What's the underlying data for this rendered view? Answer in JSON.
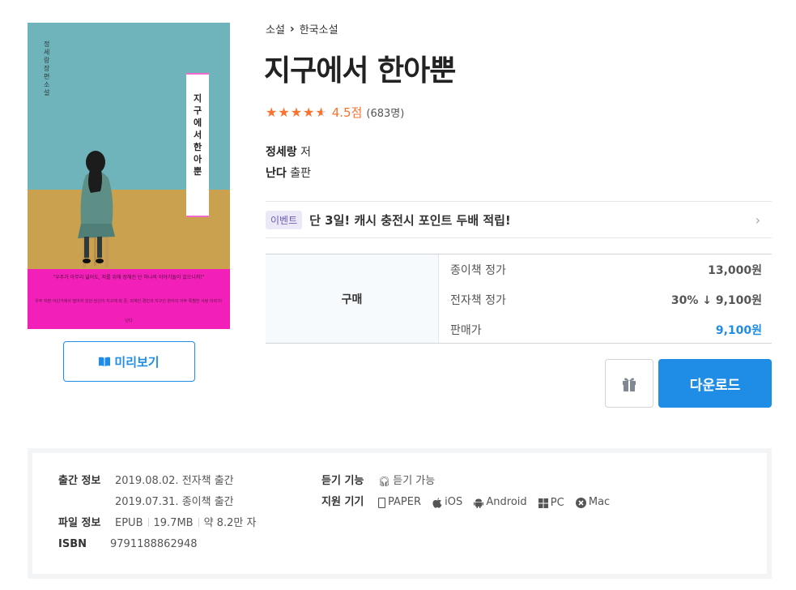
{
  "cover": {
    "author_vertical": "정세랑 장편소설",
    "title_vertical": "지구에서 한아뿐",
    "quote": "\"우주가 아무리 넓어도, 저를 위해 정해진 단 하나의 이야기들이 있으니까!\"",
    "desc": "우주 저편 어딘가에서 떨어져 있던 당신이 지구에 와 준, 외계인 경민과 지구인 한아의 아주 특별한 사랑 이야기!",
    "publisher_mark": "난다"
  },
  "preview": {
    "icon": "book-open-icon",
    "label": "미리보기"
  },
  "breadcrumb": {
    "category": "소설",
    "subcategory": "한국소설"
  },
  "book": {
    "title": "지구에서 한아뿐",
    "rating_score": "4.5점",
    "rating_count": "(683명)",
    "rating_value": 4.5,
    "author_name": "정세랑",
    "author_suffix": "저",
    "publisher_name": "난다",
    "publisher_suffix": "출판"
  },
  "event": {
    "badge": "이벤트",
    "text": "단 3일! 캐시 충전시 포인트 두배 적립!"
  },
  "price": {
    "header": "구매",
    "rows": [
      {
        "label": "종이책 정가",
        "value": "13,000원"
      },
      {
        "label": "전자책 정가",
        "value": "30% ↓ 9,100원"
      },
      {
        "label": "판매가",
        "value": "9,100원"
      }
    ]
  },
  "actions": {
    "gift_icon": "gift-icon",
    "download_label": "다운로드"
  },
  "meta": {
    "release_label": "출간 정보",
    "release_ebook": "2019.08.02. 전자책 출간",
    "release_paper": "2019.07.31. 종이책 출간",
    "file_label": "파일 정보",
    "file_format": "EPUB",
    "file_size": "19.7MB",
    "file_length": "약 8.2만 자",
    "isbn_label": "ISBN",
    "isbn_value": "9791188862948",
    "listen_label": "듣기 기능",
    "listen_value": "듣기 가능",
    "devices_label": "지원 기기",
    "devices": [
      "PAPER",
      "iOS",
      "Android",
      "PC",
      "Mac"
    ]
  },
  "colors": {
    "accent": "#1f8ce6",
    "rating": "#fa722e",
    "event_badge_bg": "#ece8f8"
  }
}
